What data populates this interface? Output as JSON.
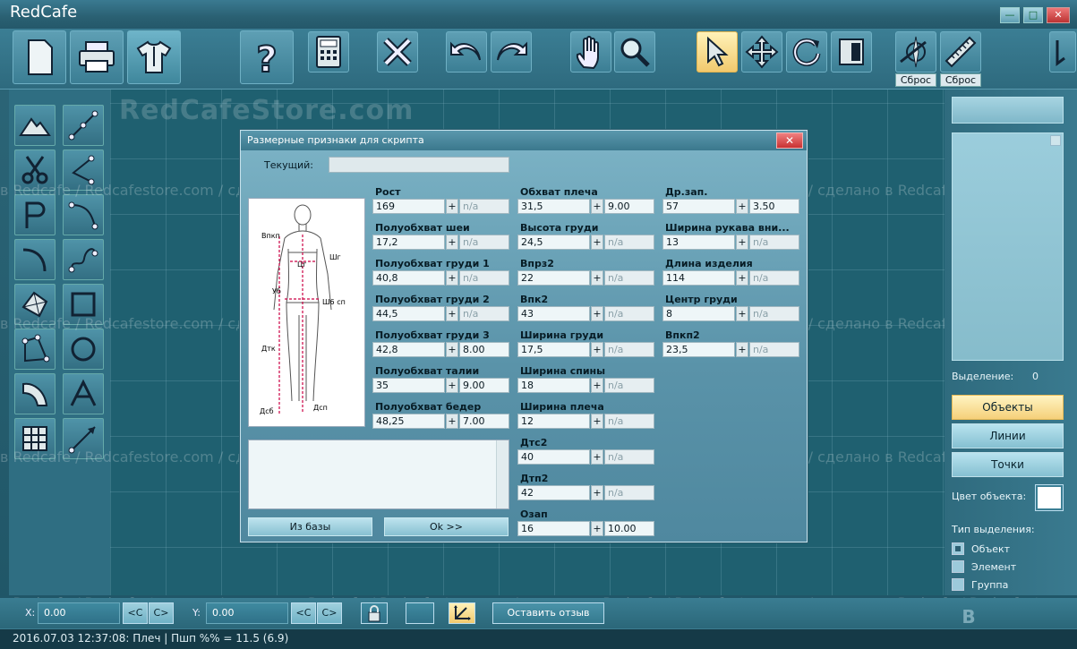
{
  "window": {
    "title": "RedCafe",
    "min": "—",
    "max": "□",
    "close": "✕"
  },
  "toolbar": {
    "reset1": "Сброс",
    "reset2": "Сброс"
  },
  "watermark": {
    "brand": "RedCafeStore.com",
    "line": "в Redcafe / Redcafestore.com / сделано в Redcafe / Redcafestore.com / сделано в Redcafe / Redcafestore.com / сделано в Redcafe / Redcafestore.com / сделано"
  },
  "right_panel": {
    "selection_label": "Выделение:",
    "selection_count": "0",
    "objects_btn": "Объекты",
    "lines_btn": "Линии",
    "points_btn": "Точки",
    "object_color_label": "Цвет объекта:",
    "object_color": "#ffffff",
    "selection_type_label": "Тип выделения:",
    "options": [
      {
        "label": "Объект",
        "checked": true
      },
      {
        "label": "Элемент",
        "checked": false
      },
      {
        "label": "Группа",
        "checked": false
      }
    ]
  },
  "bottom": {
    "x_label": "X:",
    "x_value": "0.00",
    "y_label": "Y:",
    "y_value": "0.00",
    "prev": "<C",
    "next": "C>",
    "feedback": "Оставить отзыв"
  },
  "status": "2016.07.03 12:37:08: Плеч | Пшп %% = 11.5 (6.9)",
  "dialog": {
    "title": "Размерные признаки для скрипта",
    "close": "✕",
    "current_label": "Текущий:",
    "current_value": "",
    "from_db": "Из базы",
    "ok": "Ok >>",
    "plus": "+",
    "figure_labels": {
      "vpk": "Впкп",
      "shg": "Шг",
      "cg": "Цг",
      "ub": "Уб",
      "shbsp": "Ш6 сп",
      "dtk": "Дтк",
      "dsb": "Дсб",
      "dsp": "Дсп"
    },
    "columns": [
      [
        {
          "label": "Рост",
          "value": "169",
          "extra": "n/a"
        },
        {
          "label": "Полуобхват шеи",
          "value": "17,2",
          "extra": "n/a"
        },
        {
          "label": "Полуобхват груди 1",
          "value": "40,8",
          "extra": "n/a"
        },
        {
          "label": "Полуобхват груди 2",
          "value": "44,5",
          "extra": "n/a"
        },
        {
          "label": "Полуобхват груди 3",
          "value": "42,8",
          "extra": "8.00"
        },
        {
          "label": "Полуобхват талии",
          "value": "35",
          "extra": "9.00"
        },
        {
          "label": "Полуобхват бедер",
          "value": "48,25",
          "extra": "7.00"
        }
      ],
      [
        {
          "label": "Обхват плеча",
          "value": "31,5",
          "extra": "9.00"
        },
        {
          "label": "Высота груди",
          "value": "24,5",
          "extra": "n/a"
        },
        {
          "label": "Впрз2",
          "value": "22",
          "extra": "n/a"
        },
        {
          "label": "Впк2",
          "value": "43",
          "extra": "n/a"
        },
        {
          "label": "Ширина груди",
          "value": "17,5",
          "extra": "n/a"
        },
        {
          "label": "Ширина спины",
          "value": "18",
          "extra": "n/a"
        },
        {
          "label": "Ширина плеча",
          "value": "12",
          "extra": "n/a"
        },
        {
          "label": "Дтс2",
          "value": "40",
          "extra": "n/a"
        },
        {
          "label": "Дтп2",
          "value": "42",
          "extra": "n/a"
        },
        {
          "label": "Озап",
          "value": "16",
          "extra": "10.00"
        }
      ],
      [
        {
          "label": "Др.зап.",
          "value": "57",
          "extra": "3.50"
        },
        {
          "label": "Ширина рукава вни...",
          "value": "13",
          "extra": "n/a"
        },
        {
          "label": "Длина изделия",
          "value": "114",
          "extra": "n/a"
        },
        {
          "label": "Центр груди",
          "value": "8",
          "extra": "n/a"
        },
        {
          "label": "Впкп2",
          "value": "23,5",
          "extra": "n/a"
        }
      ]
    ]
  }
}
